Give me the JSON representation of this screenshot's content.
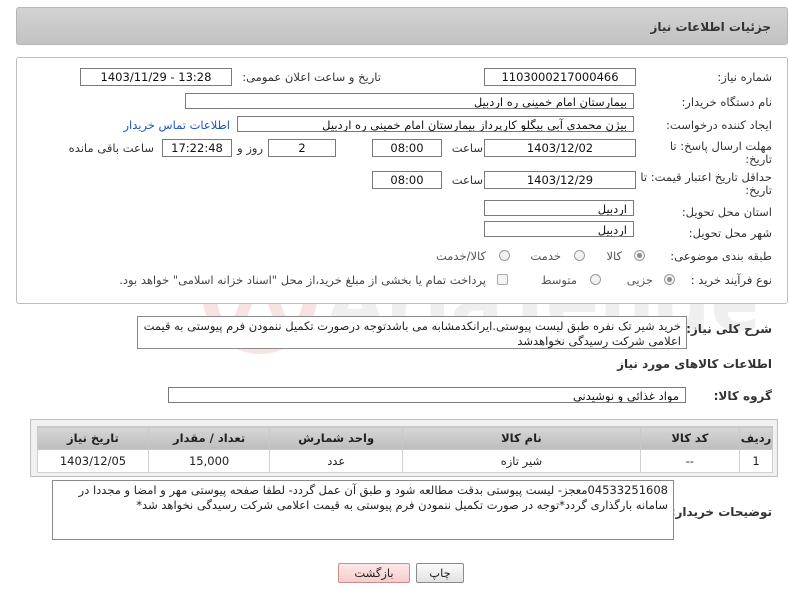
{
  "header": {
    "title": "جزئیات اطلاعات نیاز"
  },
  "form": {
    "need_number": {
      "label": "شماره نیاز:",
      "value": "1103000217000466"
    },
    "announce_datetime": {
      "label": "تاریخ و ساعت اعلان عمومی:",
      "value": "1403/11/29 - 13:28"
    },
    "buyer_org": {
      "label": "نام دستگاه خریدار:",
      "value": "بیمارستان امام خمینی  ره  اردبیل"
    },
    "requester": {
      "label": "ایجاد کننده درخواست:",
      "value": "بیژن محمدی آبی بیگلو کارپرداز بیمارستان امام خمینی  ره  اردبیل",
      "contact_link": "اطلاعات تماس خریدار"
    },
    "reply_deadline": {
      "label_line1": "مهلت ارسال پاسخ: تا",
      "label_line2": "تاریخ:",
      "date": "1403/12/02",
      "time_label": "ساعت",
      "time": "08:00",
      "days": "2",
      "days_label": "روز و",
      "remaining": "17:22:48",
      "remaining_label": "ساعت باقی مانده"
    },
    "price_validity": {
      "label_line1": "حداقل تاریخ اعتبار قیمت: تا",
      "label_line2": "تاریخ:",
      "date": "1403/12/29",
      "time_label": "ساعت",
      "time": "08:00"
    },
    "province": {
      "label": "استان محل تحویل:",
      "value": "اردبیل"
    },
    "city": {
      "label": "شهر محل تحویل:",
      "value": "اردبیل"
    },
    "category": {
      "label": "طبقه بندی موضوعی:",
      "options": [
        "کالا",
        "خدمت",
        "کالا/خدمت"
      ],
      "selected": "کالا"
    },
    "purchase_process": {
      "label": "نوع فرآیند خرید :",
      "options": [
        "جزیی",
        "متوسط"
      ],
      "selected": "جزیی",
      "note": "پرداخت تمام یا بخشی از مبلغ خرید،از محل \"اسناد خزانه اسلامی\" خواهد بود."
    }
  },
  "summary": {
    "label": "شرح کلی نیاز:",
    "text": "خرید شیر تک نفره طبق لیست پیوستی.ایرانکدمشابه می باشدتوجه درصورت تکمیل ننمودن فرم پیوستی به قیمت اعلامی شرکت رسیدگی نخواهدشد"
  },
  "goods": {
    "section_title": "اطلاعات کالاهای مورد نیاز",
    "group_label": "گروه کالا:",
    "group_value": "مواد غذائی و نوشیدنی",
    "columns": [
      "ردیف",
      "کد کالا",
      "نام کالا",
      "واحد شمارش",
      "تعداد / مقدار",
      "تاریخ نیاز"
    ],
    "rows": [
      {
        "row": "1",
        "code": "--",
        "name": "شیر تازه",
        "unit": "عدد",
        "qty": "15,000",
        "date": "1403/12/05"
      }
    ]
  },
  "buyer_notes": {
    "label": "توضیحات خریدار:",
    "text": "04533251608معجز- لیست پیوستی بدقت مطالعه شود و طبق آن عمل گردد- لطفا صفحه پیوستی مهر و امضا و مجددا در سامانه بارگذاری گردد*توجه در صورت تکمیل ننمودن فرم پیوستی به قیمت اعلامی شرکت رسیدگی نخواهد شد*"
  },
  "buttons": {
    "print": "چاپ",
    "back": "بازگشت"
  },
  "colors": {
    "link": "#1a56c4",
    "header_bg": "#c8c8c8",
    "back_button": "#f6cccc"
  },
  "watermark": {
    "text": "AriaTender.neT"
  }
}
